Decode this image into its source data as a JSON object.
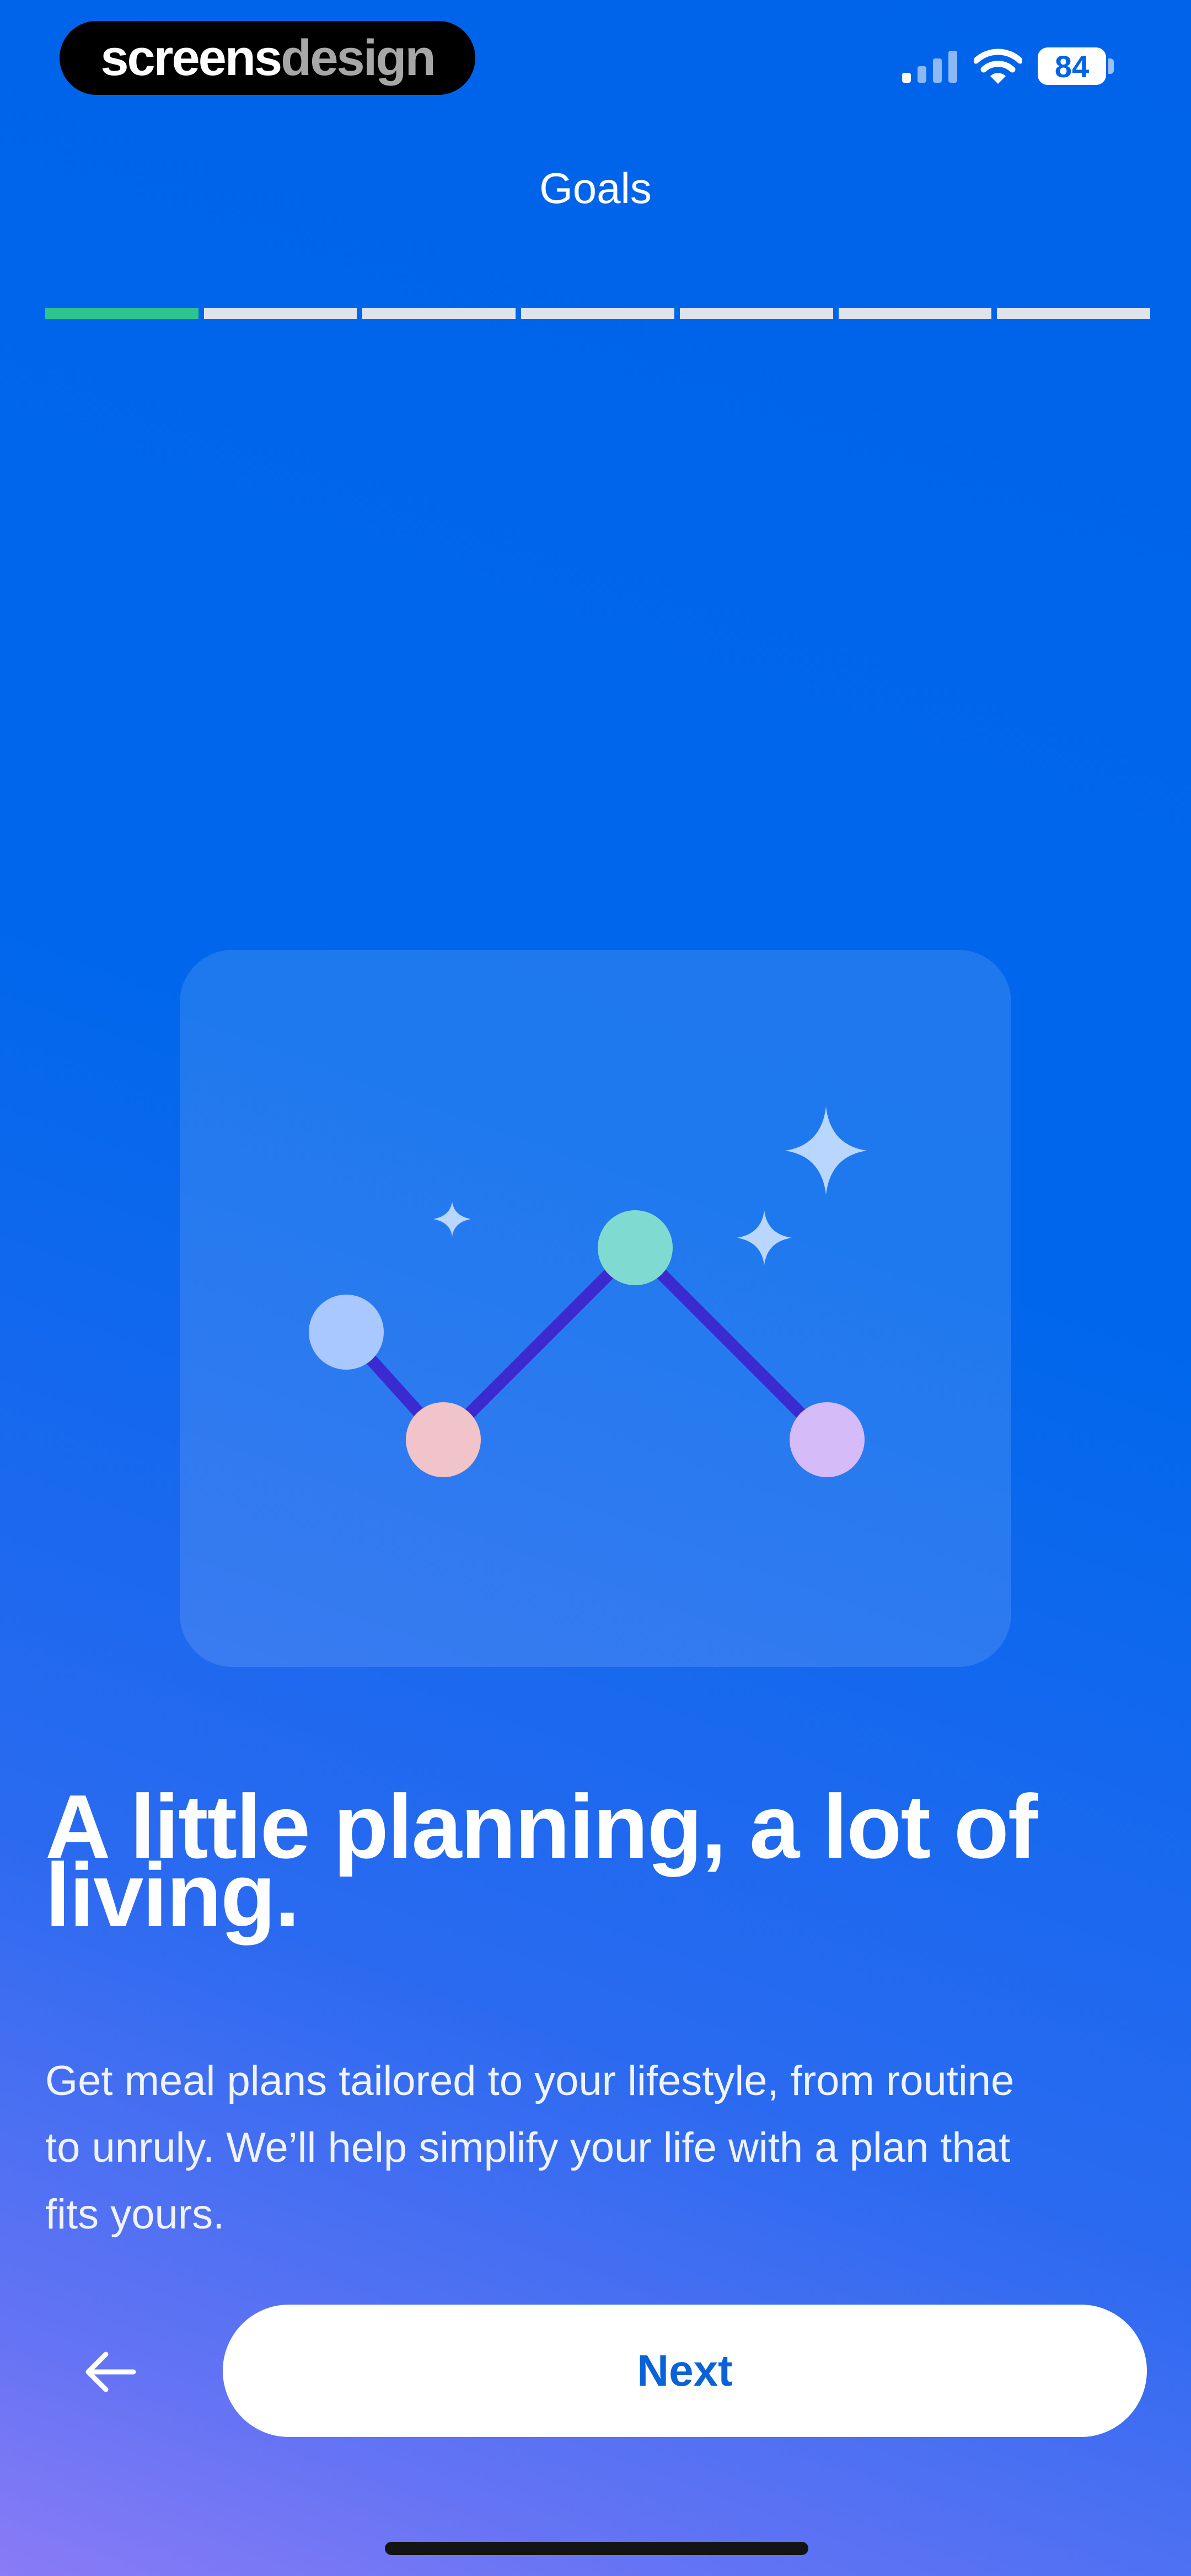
{
  "status_bar": {
    "brand_part1": "screens",
    "brand_part2": "design",
    "battery_level": "84",
    "icons": [
      "cellular-signal-icon",
      "wifi-icon",
      "battery-icon"
    ]
  },
  "header": {
    "title": "Goals"
  },
  "progress": {
    "total_steps": 7,
    "current_step": 1,
    "active_color": "#2cc58f",
    "inactive_color": "#dfe3ea"
  },
  "illustration": {
    "icon": "progress-chart-icon",
    "node_colors": [
      "#a9c8ff",
      "#f0c4c8",
      "#7fdbd1",
      "#d6bbf9"
    ],
    "line_color": "#3a2ad0",
    "sparkle_color": "#b9d6ff"
  },
  "content": {
    "headline_line1": "A little planning, a lot of",
    "headline_line2": "living.",
    "body_line1": "Get meal plans tailored to your lifestyle, from routine",
    "body_line2": "to unruly. We’ll help simplify your life with a plan that",
    "body_line3": "fits yours."
  },
  "footer": {
    "back_icon": "arrow-left-icon",
    "next_label": "Next"
  },
  "colors": {
    "background": "#0063ea",
    "accent": "#0a63d6"
  }
}
